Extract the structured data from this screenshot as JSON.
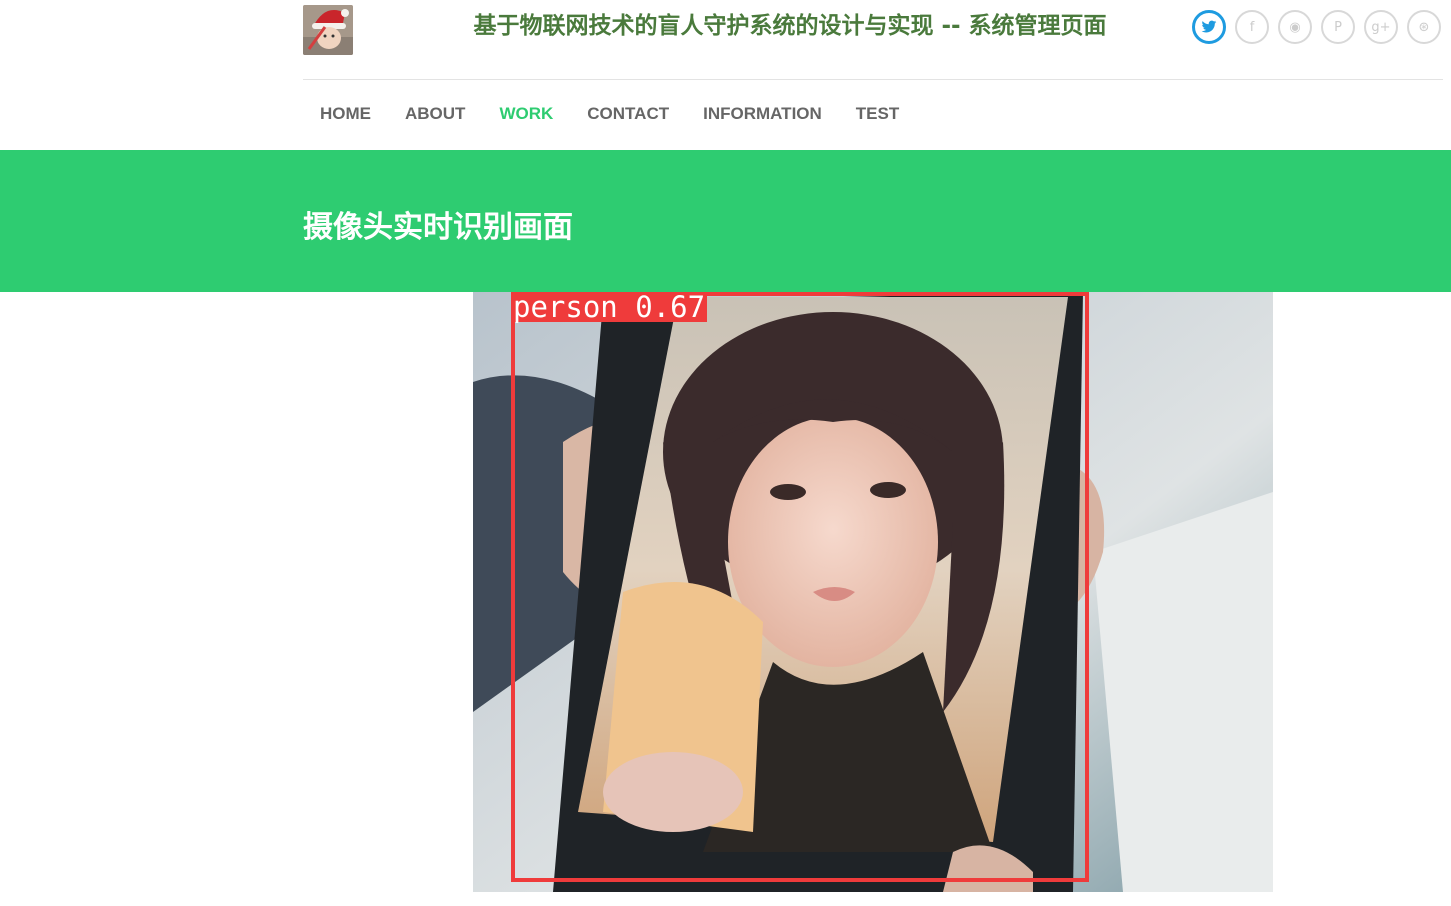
{
  "header": {
    "site_title": "基于物联网技术的盲人守护系统的设计与实现 -- 系统管理页面",
    "logo_icon": "avatar-santa-hat-icon",
    "social": [
      {
        "name": "twitter-icon",
        "glyph": "🐦",
        "active": true
      },
      {
        "name": "facebook-icon",
        "glyph": "f",
        "active": false
      },
      {
        "name": "rss-icon",
        "glyph": "◉",
        "active": false
      },
      {
        "name": "pinterest-icon",
        "glyph": "P",
        "active": false
      },
      {
        "name": "google-plus-icon",
        "glyph": "g+",
        "active": false
      },
      {
        "name": "dribbble-icon",
        "glyph": "⊛",
        "active": false
      }
    ],
    "accent_color": "#1e9be0"
  },
  "nav": {
    "items": [
      {
        "label": "HOME",
        "active": false
      },
      {
        "label": "ABOUT",
        "active": false
      },
      {
        "label": "WORK",
        "active": true
      },
      {
        "label": "CONTACT",
        "active": false
      },
      {
        "label": "INFORMATION",
        "active": false
      },
      {
        "label": "TEST",
        "active": false
      }
    ],
    "active_color": "#2ecc71"
  },
  "banner": {
    "title": "摄像头实时识别画面",
    "background": "#2ecc71"
  },
  "camera": {
    "detection": {
      "label": "person 0.67",
      "box_color": "#ef3b3b"
    }
  }
}
